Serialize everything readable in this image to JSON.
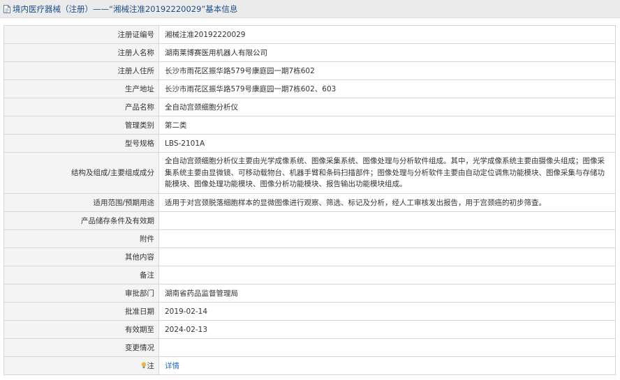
{
  "header": {
    "icon": "document-icon",
    "title": "境内医疗器械（注册）——“湘械注准20192220029”基本信息"
  },
  "rows": [
    {
      "label": "注册证编号",
      "value": "湘械注准20192220029"
    },
    {
      "label": "注册人名称",
      "value": "湖南莱博赛医用机器人有限公司"
    },
    {
      "label": "注册人住所",
      "value": "长沙市雨花区振华路579号康庭园一期7栋602"
    },
    {
      "label": "生产地址",
      "value": "长沙市雨花区振华路579号康庭园一期7栋602、603"
    },
    {
      "label": "产品名称",
      "value": "全自动宫颈细胞分析仪"
    },
    {
      "label": "管理类别",
      "value": "第二类"
    },
    {
      "label": "型号规格",
      "value": "LBS-2101A"
    },
    {
      "label": "结构及组成/主要组成成分",
      "value": "全自动宫颈细胞分析仪主要由光学成像系统、图像采集系统、图像处理与分析软件组成。其中，光学成像系统主要由摄像头组成；图像采集系统主要由显微镜、可移动载物台、机器手臂和条码扫描部件；图像处理与分析软件主要由自动定位调焦功能模块、图像采集与存储功能模块、图像处理功能模块、图像分析功能模块、报告输出功能模块组成。"
    },
    {
      "label": "适用范围/预期用途",
      "value": "适用于对宫颈脱落细胞样本的显微图像进行观察、筛选、标记及分析，经人工审核发出报告，用于宫颈癌的初步筛查。"
    },
    {
      "label": "产品储存条件及有效期",
      "value": ""
    },
    {
      "label": "附件",
      "value": ""
    },
    {
      "label": "其他内容",
      "value": ""
    },
    {
      "label": "备注",
      "value": ""
    },
    {
      "label": "审批部门",
      "value": "湖南省药品监督管理局"
    },
    {
      "label": "批准日期",
      "value": "2019-02-14"
    },
    {
      "label": "有效期至",
      "value": "2024-02-13"
    },
    {
      "label": "变更情况",
      "value": ""
    }
  ],
  "note": {
    "icon": "lightbulb-icon",
    "label": "注",
    "link_text": "详情"
  },
  "colors": {
    "title_text": "#1b4f8a",
    "link": "#2f6fb6",
    "label_bg": "#f4f4f4",
    "border": "#d6d6d6"
  }
}
